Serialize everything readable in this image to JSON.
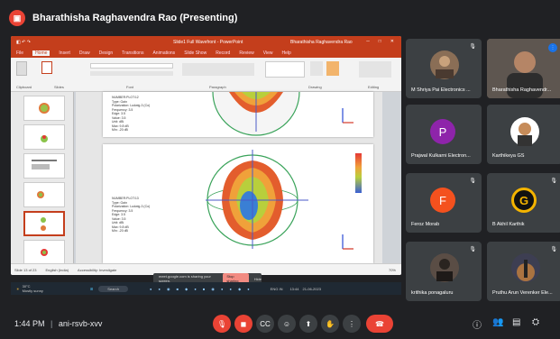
{
  "meet": {
    "presenter_banner": "Bharathisha Raghavendra Rao (Presenting)",
    "time": "1:44 PM",
    "meeting_code": "ani-rsvb-xvv"
  },
  "ppt": {
    "doc_title": "Slide1 Full Wavefront - PowerPoint",
    "user": "Bharathisha Raghavendra Rao",
    "tabs": [
      "File",
      "Home",
      "Insert",
      "Draw",
      "Design",
      "Transitions",
      "Animations",
      "Slide Show",
      "Record",
      "Review",
      "View",
      "Help"
    ],
    "groups": [
      "Clipboard",
      "Slides",
      "Font",
      "Paragraph",
      "Drawing",
      "Editing"
    ],
    "status_left": "Slide 13 of 23",
    "status_lang": "English (India)",
    "status_access": "Accessibility: Investigate",
    "zoom": "70%",
    "slide_text_a": "NUMBER:PLOT:12\nType: Gain\nPolarization: Ludwig-3 (Co)\nFrequency: 3.5\nEdge: 3.5\nValue: 3.5\nUnit: dBi\nMax: 9.8 dB\nMin: -20 dB",
    "slide_text_b": "NUMBER:PLOT:13\nType: Gain\nPolarization: Ludwig-3 (Co)\nFrequency: 3.5\nEdge: 3.5\nValue: 3.5\nUnit: dBi\nMax: 9.8 dB\nMin: -20 dB"
  },
  "share_notice": {
    "text": "meet.google.com is sharing your screen.",
    "stop": "Stop sharing",
    "hide": "Hide"
  },
  "taskbar": {
    "weather": "30°C",
    "weather_sub": "Mostly sunny",
    "search": "Search",
    "lang": "ENG IN",
    "clock": "13:44",
    "date": "21-06-2023"
  },
  "participants": [
    {
      "name": "M Shriya Pai Electronics ...",
      "initial": "",
      "color": "#8a6e56"
    },
    {
      "name": "Bharathisha Raghavendr...",
      "initial": "",
      "color": "#6d6257"
    },
    {
      "name": "Prajwal Kulkarni Electron...",
      "initial": "P",
      "color": "#8e24aa"
    },
    {
      "name": "Karthikeya GS",
      "initial": "",
      "color": "#55534f"
    },
    {
      "name": "Feroz Morab",
      "initial": "F",
      "color": "#f4511e"
    },
    {
      "name": "B Akhil Karthik",
      "initial": "G",
      "color": "#3c4043"
    },
    {
      "name": "krithika ponagaluru",
      "initial": "",
      "color": "#5a4d45"
    },
    {
      "name": "Pruthu Arun Verenker Ele...",
      "initial": "",
      "color": "#3d3e52"
    }
  ],
  "colors": {
    "ppt_accent": "#c43e1c",
    "leave": "#ea4335",
    "bg": "#202124"
  },
  "icons": [
    "mic-off-icon",
    "camera-off-icon",
    "captions-icon",
    "emoji-icon",
    "present-icon",
    "raise-hand-icon",
    "more-icon",
    "end-call-icon",
    "info-icon",
    "people-icon",
    "chat-icon",
    "activities-icon"
  ]
}
